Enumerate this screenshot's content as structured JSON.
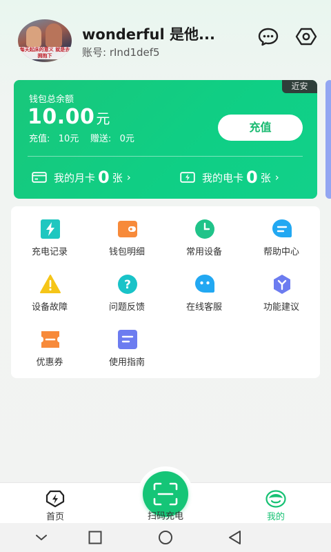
{
  "profile": {
    "avatar_caption": "每天起床的意义 就是去拥抱下",
    "username": "wonderful 是他...",
    "account_label": "账号:",
    "account_id": "rInd1def5"
  },
  "wallet": {
    "region_tag": "近安",
    "balance_label": "钱包总余额",
    "balance_amount": "10.00",
    "balance_unit": "元",
    "detail": "充值:   10元    赠送:   0元",
    "recharge_button": "充值",
    "month_card": {
      "prefix": "我的月卡",
      "count": "0",
      "unit": "张",
      "chevron": "›"
    },
    "elec_card": {
      "prefix": "我的电卡",
      "count": "0",
      "unit": "张",
      "chevron": "›"
    }
  },
  "menu": {
    "items": [
      {
        "label": "充电记录",
        "icon": "charge-record-icon",
        "color": "#1fc7c0"
      },
      {
        "label": "钱包明细",
        "icon": "wallet-detail-icon",
        "color": "#f78a3a"
      },
      {
        "label": "常用设备",
        "icon": "clock-icon",
        "color": "#20c389"
      },
      {
        "label": "帮助中心",
        "icon": "help-chat-icon",
        "color": "#22a8f2"
      },
      {
        "label": "设备故障",
        "icon": "warning-icon",
        "color": "#f5c518"
      },
      {
        "label": "问题反馈",
        "icon": "question-icon",
        "color": "#19c3c8"
      },
      {
        "label": "在线客服",
        "icon": "service-chat-icon",
        "color": "#22a8f2"
      },
      {
        "label": "功能建议",
        "icon": "suggestion-icon",
        "color": "#6c7cf0"
      },
      {
        "label": "优惠券",
        "icon": "coupon-icon",
        "color": "#f78a3a"
      },
      {
        "label": "使用指南",
        "icon": "guide-icon",
        "color": "#6c7cf0"
      }
    ]
  },
  "tabbar": {
    "home": "首页",
    "scan": "扫码充电",
    "mine": "我的",
    "active_color": "#16c173"
  },
  "colors": {
    "brand": "#15c577"
  }
}
